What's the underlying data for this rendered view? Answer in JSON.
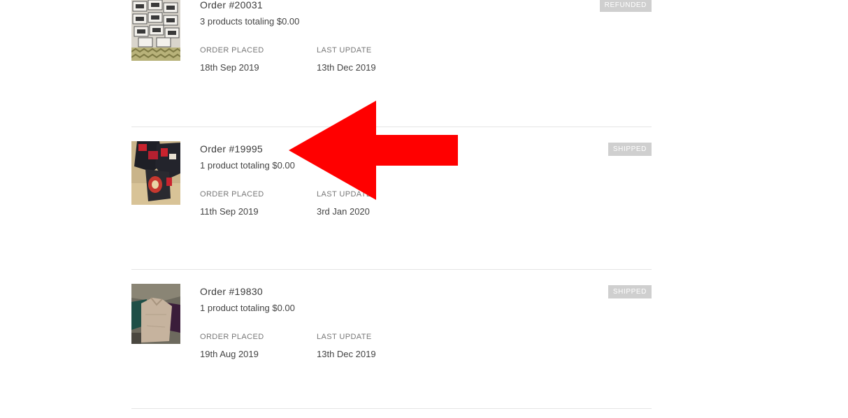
{
  "orders": [
    {
      "title": "Order #20031",
      "summary": "3 products totaling $0.00",
      "placed_label": "ORDER PLACED",
      "placed_value": "18th Sep 2019",
      "update_label": "LAST UPDATE",
      "update_value": "13th Dec 2019",
      "status": "REFUNDED",
      "thumbnail": "boxes-photo"
    },
    {
      "title": "Order #19995",
      "summary": "1 product totaling $0.00",
      "placed_label": "ORDER PLACED",
      "placed_value": "11th Sep 2019",
      "update_label": "LAST UPDATE",
      "update_value": "3rd Jan 2020",
      "status": "SHIPPED",
      "thumbnail": "garments-photo"
    },
    {
      "title": "Order #19830",
      "summary": "1 product totaling $0.00",
      "placed_label": "ORDER PLACED",
      "placed_value": "19th Aug 2019",
      "update_label": "LAST UPDATE",
      "update_value": "13th Dec 2019",
      "status": "SHIPPED",
      "thumbnail": "clothing-photo"
    }
  ],
  "colors": {
    "badge_bg": "#cfcfcf",
    "badge_text": "#ffffff",
    "arrow": "#ff0000",
    "divider": "#e5e5e5"
  },
  "annotation": {
    "icon": "red-arrow-left-icon"
  }
}
